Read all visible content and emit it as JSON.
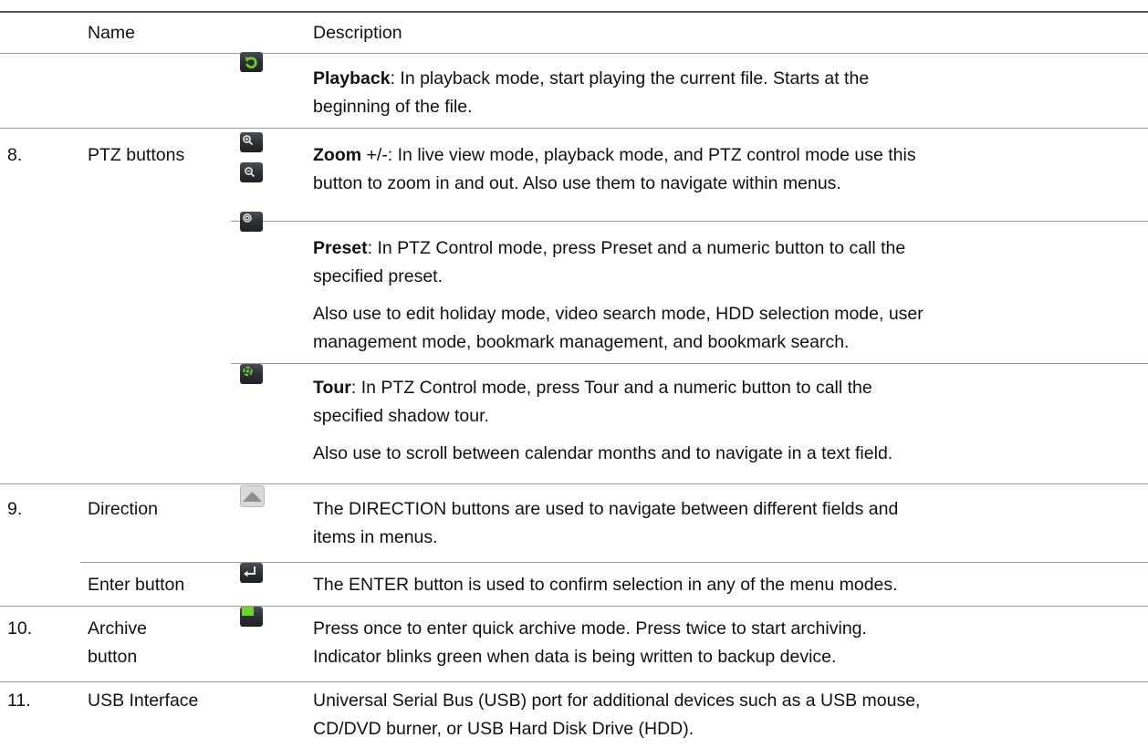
{
  "header": {
    "name": "Name",
    "description": "Description"
  },
  "rows": {
    "playback": {
      "title": "Playback",
      "desc_1": ": In playback mode, start playing the current file. Starts at the",
      "desc_2": "beginning of the file.",
      "icon": "playback-icon"
    },
    "ptz": {
      "num": "8.",
      "name": "PTZ buttons",
      "zoom": {
        "title": "Zoom",
        "suffix": " +/-",
        "desc_1": ": In live view mode, playback mode, and PTZ control mode use this",
        "desc_2": "button to zoom in and out. Also use them to navigate within menus.",
        "icons": [
          "zoom-in-icon",
          "zoom-out-icon"
        ]
      },
      "preset": {
        "title": "Preset",
        "desc_1": ": In PTZ Control mode, press Preset and a numeric button to call the",
        "desc_2": "specified preset.",
        "extra_1": "Also use to edit holiday mode, video search mode, HDD selection mode, user",
        "extra_2": "management mode, bookmark management, and bookmark search.",
        "icon": "preset-icon"
      },
      "tour": {
        "title": "Tour",
        "desc_1": ": In PTZ Control mode, press Tour and a numeric button to call the",
        "desc_2": "specified shadow tour.",
        "extra_1": "Also use to scroll between calendar months and to navigate in a text field.",
        "icon": "tour-icon"
      }
    },
    "direction": {
      "num": "9.",
      "name": "Direction",
      "desc_1": "The DIRECTION buttons are used to navigate between different fields and",
      "desc_2": "items in menus.",
      "icon": "direction-up-icon"
    },
    "enter": {
      "name": "Enter button",
      "desc_1": "The ENTER button is used to confirm selection in any of the menu modes.",
      "icon": "enter-icon"
    },
    "archive": {
      "num": "10.",
      "name_1": "Archive",
      "name_2": "button",
      "desc_1": "Press once to enter quick archive mode. Press twice to start archiving.",
      "desc_2": "Indicator blinks green when data is being written to backup device.",
      "icon": "archive-icon"
    },
    "usb": {
      "num": "11.",
      "name": "USB Interface",
      "desc_1": "Universal Serial Bus (USB) port for additional devices such as a USB mouse,",
      "desc_2": "CD/DVD burner, or USB Hard Disk Drive (HDD)."
    }
  },
  "colors": {
    "icon_bg": "#2c3034",
    "icon_green": "#6fd42a",
    "rule": "#9a9a9a"
  }
}
